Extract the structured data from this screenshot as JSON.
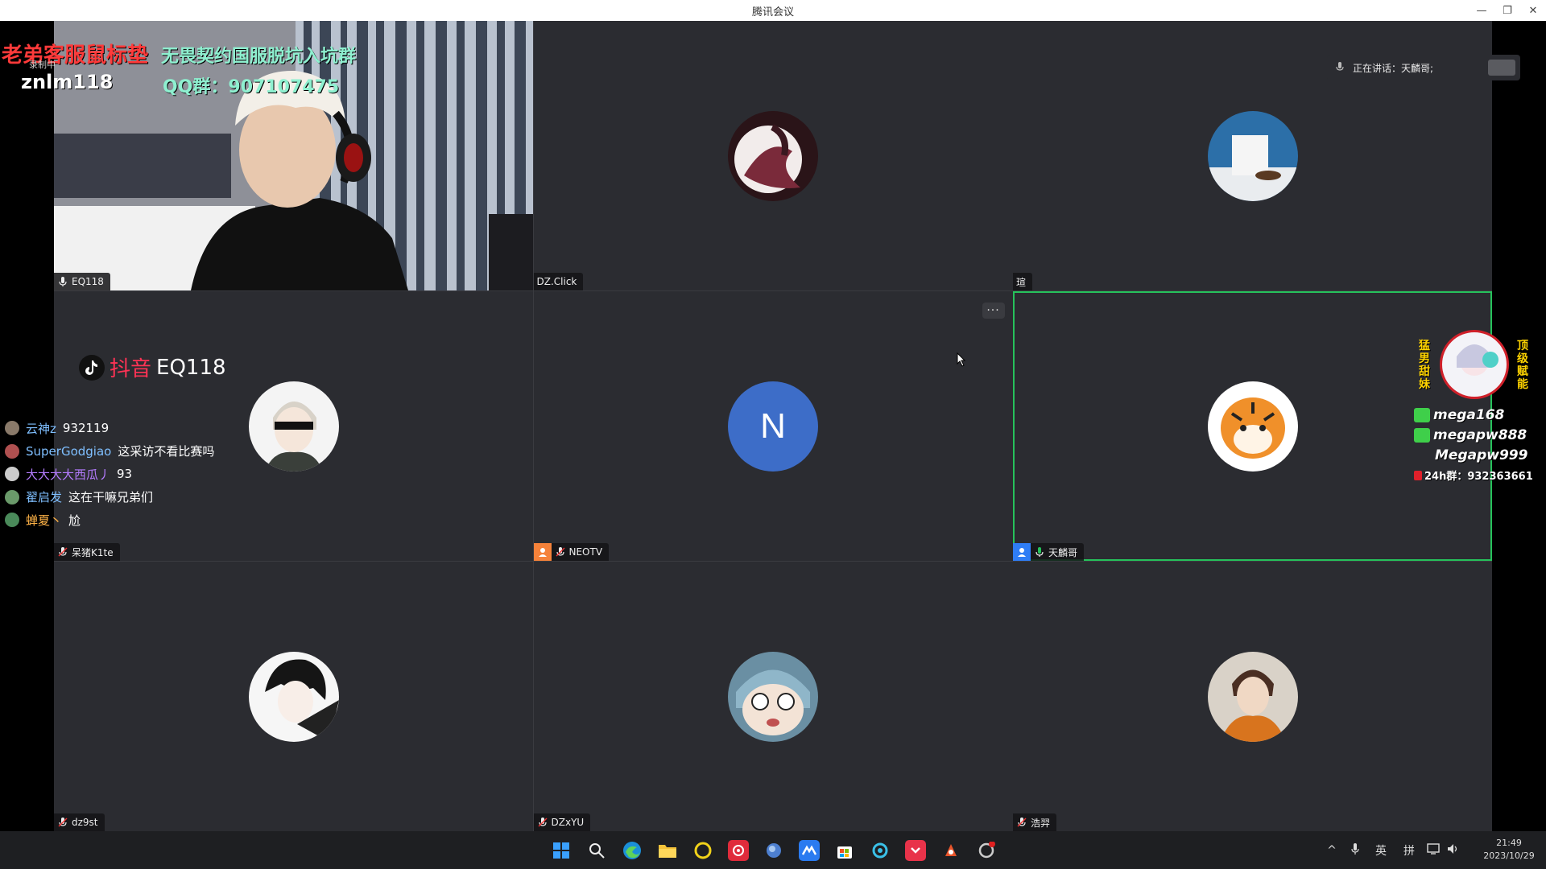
{
  "window": {
    "title": "腾讯会议",
    "minimize": "—",
    "restore": "❐",
    "close": "✕"
  },
  "speaking_indicator": {
    "text": "正在讲话：天麟哥;"
  },
  "tiles": [
    {
      "name": "EQ118",
      "kind": "video"
    },
    {
      "name": "DZ.Click",
      "kind": "avatar"
    },
    {
      "name": "瑄",
      "kind": "avatar"
    },
    {
      "name": "呆猪K1te",
      "kind": "avatar"
    },
    {
      "name": "NEOTV",
      "kind": "letter",
      "letter": "N",
      "more": "···"
    },
    {
      "name": "天麟哥",
      "kind": "avatar",
      "active": true
    },
    {
      "name": "dz9st",
      "kind": "avatar"
    },
    {
      "name": "DZxYU",
      "kind": "avatar"
    },
    {
      "name": "浩羿",
      "kind": "avatar"
    }
  ],
  "overlays": {
    "top_red": "老弟客服鼠标垫",
    "top_id": "znlm118",
    "top_green": "无畏契约国服脱坑入坑群",
    "top_qq": "QQ群：907107475",
    "recording": "录制中",
    "douyin_label": "抖音",
    "douyin_id": "EQ118",
    "right_vert_left": "猛男甜妹",
    "right_vert_right": "顶级赋能",
    "right_lines": [
      "mega168",
      "megapw888",
      "Megapw999",
      "24h群：932363661"
    ]
  },
  "chat": [
    {
      "user": "云神z",
      "msg": "932119",
      "color": "#7fbfff"
    },
    {
      "user": "SuperGodgiao",
      "msg": "这采访不看比赛吗",
      "color": "#7fbfff"
    },
    {
      "user": "大大大大西瓜丿",
      "msg": "93",
      "color": "#b57cff"
    },
    {
      "user": "翟启发",
      "msg": "这在干嘛兄弟们",
      "color": "#7fbfff"
    },
    {
      "user": "蝉夏丶",
      "msg": "尬",
      "color": "#ffb347"
    }
  ],
  "taskbar": {
    "apps": [
      "windows-start",
      "search",
      "edge",
      "file-explorer",
      "app-yellow",
      "netease-music",
      "app-blue",
      "tencent-meeting",
      "ms-store",
      "app-cyan",
      "pocket",
      "app-red",
      "app-settings"
    ],
    "tray": {
      "chevron": "^",
      "mic": "🎙",
      "lang": "英",
      "ime": "拼",
      "net": "🖵",
      "vol": "🔈"
    },
    "time": "21:49",
    "date": "2023/10/29"
  },
  "colors": {
    "active_border": "#26c25b",
    "tile_bg": "#2b2c31",
    "letter_avatar": "#3d6dc8"
  }
}
